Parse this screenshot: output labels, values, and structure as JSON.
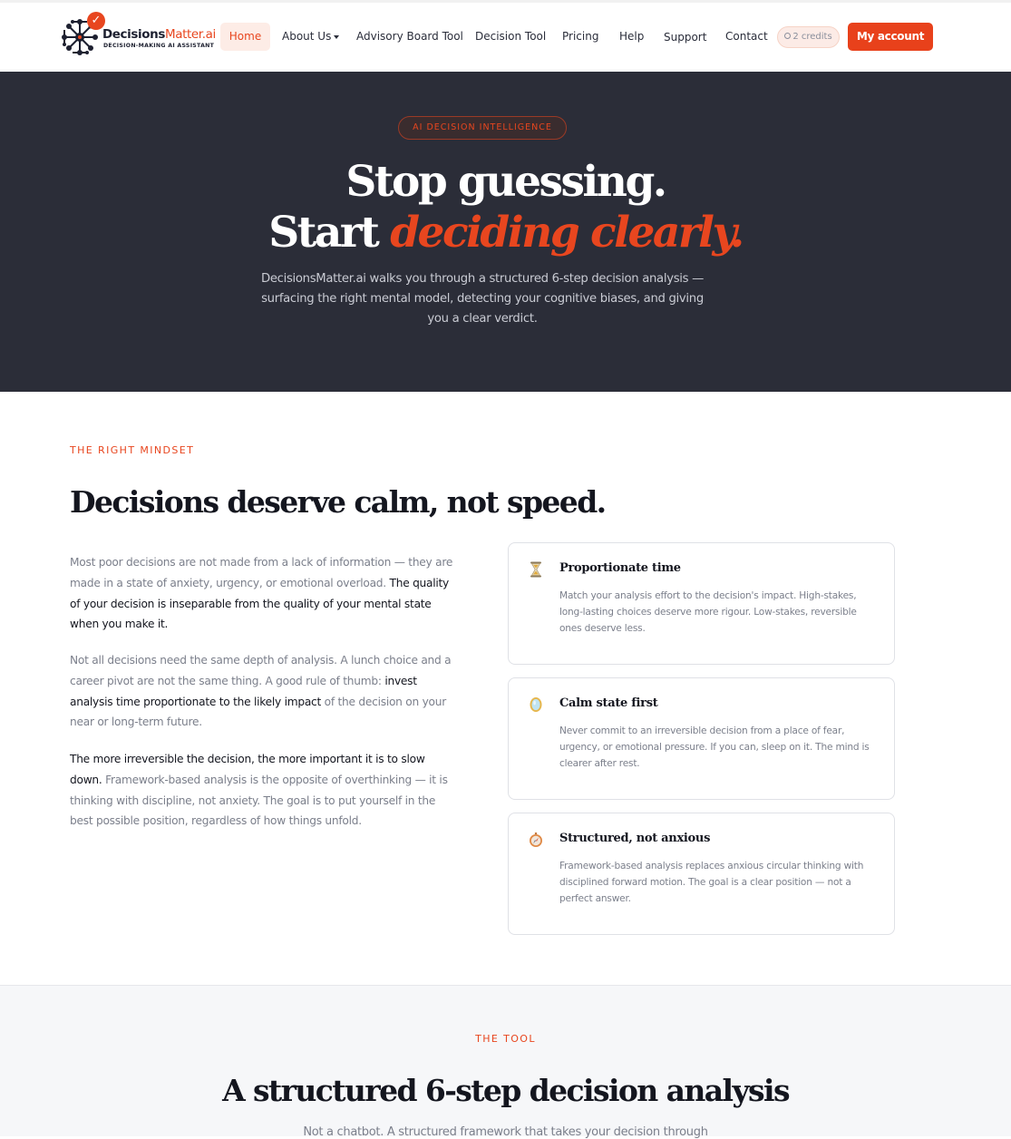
{
  "brand": {
    "name_main": "Decisions",
    "name_accent": "Matter.ai",
    "tagline": "DECISION-MAKING AI ASSISTANT",
    "logo_icon": "network-brain-icon",
    "check_icon": "check-badge-icon"
  },
  "nav": {
    "home": "Home",
    "about": "About Us",
    "advisory": "Advisory Board Tool",
    "decision_tool": "Decision Tool",
    "pricing": "Pricing",
    "help": "Help",
    "support": "Support",
    "contact": "Contact",
    "credits": "2 credits",
    "account": "My account"
  },
  "hero": {
    "badge": "AI DECISION INTELLIGENCE",
    "title_line1": "Stop guessing.",
    "title_line2_plain": "Start ",
    "title_line2_accent": "deciding clearly.",
    "description": "DecisionsMatter.ai walks you through a structured 6-step decision analysis — surfacing the right mental model, detecting your cognitive biases, and giving you a clear verdict."
  },
  "mindset": {
    "eyebrow": "THE RIGHT MINDSET",
    "title": "Decisions deserve calm, not speed.",
    "p1_a": "Most poor decisions are not made from a lack of information — they are made in a state of anxiety, urgency, or emotional overload. ",
    "p1_b": "The quality of your decision is inseparable from the quality of your mental state when you make it.",
    "p2_a": "Not all decisions need the same depth of analysis. A lunch choice and a career pivot are not the same thing. A good rule of thumb: ",
    "p2_b": "invest analysis time proportionate to the likely impact",
    "p2_c": " of the decision on your near or long-term future.",
    "p3_a": "The more irreversible the decision, the more important it is to slow down.",
    "p3_b": " Framework-based analysis is the opposite of overthinking — it is thinking with discipline, not anxiety. The goal is to put yourself in the best possible position, regardless of how things unfold.",
    "cards": [
      {
        "icon": "hourglass-icon",
        "title": "Proportionate time",
        "body": "Match your analysis effort to the decision's impact. High-stakes, long-lasting choices deserve more rigour. Low-stakes, reversible ones deserve less."
      },
      {
        "icon": "mirror-icon",
        "title": "Calm state first",
        "body": "Never commit to an irreversible decision from a place of fear, urgency, or emotional pressure. If you can, sleep on it. The mind is clearer after rest."
      },
      {
        "icon": "compass-icon",
        "title": "Structured, not anxious",
        "body": "Framework-based analysis replaces anxious circular thinking with disciplined forward motion. The goal is a clear position — not a perfect answer."
      }
    ]
  },
  "tool": {
    "eyebrow": "THE TOOL",
    "title": "A structured 6-step decision analysis",
    "subtitle": "Not a chatbot. A structured framework that takes your decision through"
  },
  "colors": {
    "accent": "#e8461f",
    "hero_bg": "#2b2d38",
    "text_dark": "#14161f",
    "text_muted": "#7b7f8b"
  }
}
